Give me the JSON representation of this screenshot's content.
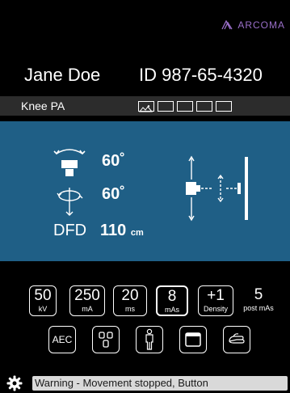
{
  "brand": {
    "name": "ARCOMA",
    "color": "#9a6fc9"
  },
  "patient": {
    "name": "Jane Doe",
    "id": "ID 987-65-4320"
  },
  "exam": {
    "name": "Knee PA",
    "thumbnails": [
      "image-icon",
      "empty",
      "empty",
      "empty",
      "empty"
    ]
  },
  "positioning": {
    "tilt_angle": "60˚",
    "rotation_angle": "60˚",
    "dfd_label": "DFD",
    "dfd_value": "110",
    "dfd_unit": "cm",
    "panel_color": "#1f5f86"
  },
  "exposure": {
    "kv": {
      "value": "50",
      "unit": "kV"
    },
    "ma": {
      "value": "250",
      "unit": "mA"
    },
    "ms": {
      "value": "20",
      "unit": "ms"
    },
    "mas": {
      "value": "8",
      "unit": "mAs"
    },
    "density": {
      "value": "+1",
      "unit": "Density"
    },
    "post_mas": {
      "value": "5",
      "unit": "post mAs"
    }
  },
  "controls": {
    "aec_label": "AEC",
    "icons": [
      "aec-chambers-icon",
      "patient-standing-icon",
      "detector-icon",
      "hand-switch-icon"
    ]
  },
  "status": {
    "icon": "gear-icon",
    "warning": "Warning - Movement stopped, Button"
  }
}
